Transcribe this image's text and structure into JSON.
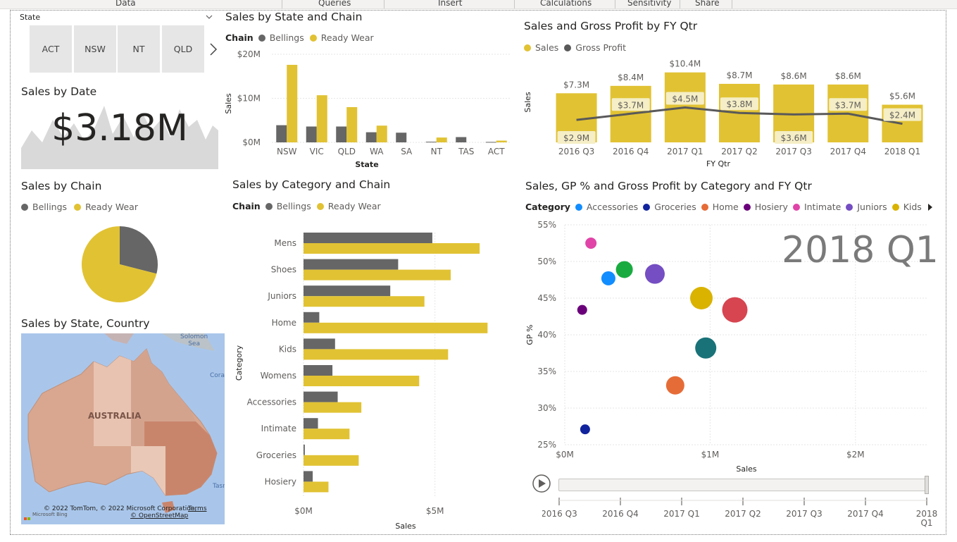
{
  "ribbon": {
    "tabs": [
      "Data",
      "Queries",
      "Insert",
      "Calculations",
      "Sensitivity",
      "Share"
    ]
  },
  "colors": {
    "bellings": "#666666",
    "ready_wear": "#e1c233",
    "accent_dark": "#595959"
  },
  "slicer": {
    "label": "State",
    "items": [
      "ACT",
      "NSW",
      "NT",
      "QLD"
    ],
    "next_icon": "chevron-right-icon"
  },
  "kpi": {
    "title": "Sales by Date",
    "value": "$3.18M"
  },
  "pie": {
    "title": "Sales by Chain",
    "legend": [
      "Bellings",
      "Ready Wear"
    ],
    "chart_data": {
      "type": "pie",
      "labels": [
        "Bellings",
        "Ready Wear"
      ],
      "values": [
        29,
        71
      ]
    }
  },
  "map": {
    "title": "Sales by State, Country",
    "country_label": "AUSTRALIA",
    "sea_label_1": "Solomon",
    "sea_label_2": "Sea",
    "coral_label": "Coral",
    "tasman_label": "Tasn",
    "attribution": "© 2022 TomTom, © 2022 Microsoft Corporation,",
    "terms": "Terms",
    "osm": "© OpenStreetMap",
    "bing": "Microsoft Bing"
  },
  "state_chain": {
    "title": "Sales by State and Chain",
    "legend_title": "Chain",
    "legend": [
      "Bellings",
      "Ready Wear"
    ],
    "y_ticks": [
      "$20M",
      "$10M",
      "$0M"
    ],
    "ylabel": "Sales",
    "xlabel": "State",
    "chart_data": {
      "type": "bar",
      "categories": [
        "NSW",
        "VIC",
        "QLD",
        "WA",
        "SA",
        "NT",
        "TAS",
        "ACT"
      ],
      "series": [
        {
          "name": "Bellings",
          "values": [
            3.9,
            3.6,
            3.6,
            2.3,
            2.2,
            0.15,
            1.2,
            0.1
          ]
        },
        {
          "name": "Ready Wear",
          "values": [
            17.6,
            10.7,
            8.0,
            3.8,
            0,
            1.1,
            0,
            0.4
          ]
        }
      ],
      "ylim": [
        0,
        20
      ]
    }
  },
  "fy_qtr": {
    "title": "Sales and Gross Profit by FY Qtr",
    "legend": [
      "Sales",
      "Gross Profit"
    ],
    "ylabel": "Sales",
    "xlabel": "FY Qtr",
    "chart_data": {
      "type": "bar",
      "categories": [
        "2016 Q3",
        "2016 Q4",
        "2017 Q1",
        "2017 Q2",
        "2017 Q3",
        "2017 Q4",
        "2018 Q1"
      ],
      "series": [
        {
          "name": "Sales",
          "values": [
            7.3,
            8.4,
            10.4,
            8.7,
            8.6,
            8.6,
            5.6
          ],
          "labels": [
            "$7.3M",
            "$8.4M",
            "$10.4M",
            "$8.7M",
            "$8.6M",
            "$8.6M",
            "$5.6M"
          ]
        },
        {
          "name": "Gross Profit",
          "values": [
            2.9,
            3.7,
            4.5,
            3.8,
            3.6,
            3.7,
            2.4
          ],
          "labels": [
            "$2.9M",
            "$3.7M",
            "$4.5M",
            "$3.8M",
            "$3.6M",
            "$3.7M",
            "$2.4M"
          ]
        }
      ],
      "ylim": [
        0,
        11
      ]
    }
  },
  "category_chain": {
    "title": "Sales by Category and Chain",
    "legend_title": "Chain",
    "legend": [
      "Bellings",
      "Ready Wear"
    ],
    "x_ticks": [
      "$0M",
      "$5M"
    ],
    "xlabel": "Sales",
    "ylabel": "Category",
    "chart_data": {
      "type": "bar",
      "categories": [
        "Mens",
        "Shoes",
        "Juniors",
        "Home",
        "Kids",
        "Womens",
        "Accessories",
        "Intimate",
        "Groceries",
        "Hosiery"
      ],
      "series": [
        {
          "name": "Bellings",
          "values": [
            4.9,
            3.6,
            3.3,
            0.6,
            1.2,
            1.1,
            1.3,
            0.55,
            0.05,
            0.35
          ]
        },
        {
          "name": "Ready Wear",
          "values": [
            6.7,
            5.6,
            4.6,
            7.0,
            5.5,
            4.4,
            2.2,
            1.75,
            2.1,
            0.95
          ]
        }
      ],
      "xlim": [
        0,
        7.5
      ]
    }
  },
  "scatter": {
    "title": "Sales, GP % and Gross Profit by Category and FY Qtr",
    "legend_title": "Category",
    "legend": [
      {
        "name": "Accessories",
        "color": "#118dff"
      },
      {
        "name": "Groceries",
        "color": "#12239e"
      },
      {
        "name": "Home",
        "color": "#e66c37"
      },
      {
        "name": "Hosiery",
        "color": "#6b007b"
      },
      {
        "name": "Intimate",
        "color": "#e044a7"
      },
      {
        "name": "Juniors",
        "color": "#744ec2"
      },
      {
        "name": "Kids",
        "color": "#d9b300"
      }
    ],
    "watermark": "2018 Q1",
    "y_ticks": [
      "55%",
      "50%",
      "45%",
      "40%",
      "35%",
      "30%",
      "25%"
    ],
    "x_ticks": [
      "$0M",
      "$1M",
      "$2M"
    ],
    "xlabel": "Sales",
    "ylabel": "GP %",
    "chart_data": {
      "type": "scatter",
      "points": [
        {
          "x": 0.18,
          "y": 52.5,
          "size": 8,
          "color": "#e044a7"
        },
        {
          "x": 0.3,
          "y": 47.7,
          "size": 10,
          "color": "#118dff"
        },
        {
          "x": 0.41,
          "y": 48.9,
          "size": 12,
          "color": "#1aab40"
        },
        {
          "x": 0.62,
          "y": 48.3,
          "size": 14,
          "color": "#744ec2"
        },
        {
          "x": 0.94,
          "y": 45.0,
          "size": 16,
          "color": "#d9b300"
        },
        {
          "x": 1.17,
          "y": 43.4,
          "size": 18,
          "color": "#d64550"
        },
        {
          "x": 0.12,
          "y": 43.4,
          "size": 7,
          "color": "#6b007b"
        },
        {
          "x": 0.97,
          "y": 38.2,
          "size": 15,
          "color": "#197278"
        },
        {
          "x": 0.76,
          "y": 33.1,
          "size": 13,
          "color": "#e66c37"
        },
        {
          "x": 0.14,
          "y": 27.1,
          "size": 7,
          "color": "#12239e"
        }
      ],
      "xlim": [
        0,
        2.5
      ],
      "ylim": [
        25,
        55
      ]
    },
    "play_axis": [
      "2016 Q3",
      "2016 Q4",
      "2017 Q1",
      "2017 Q2",
      "2017 Q3",
      "2017 Q4",
      "2018 Q1"
    ]
  }
}
